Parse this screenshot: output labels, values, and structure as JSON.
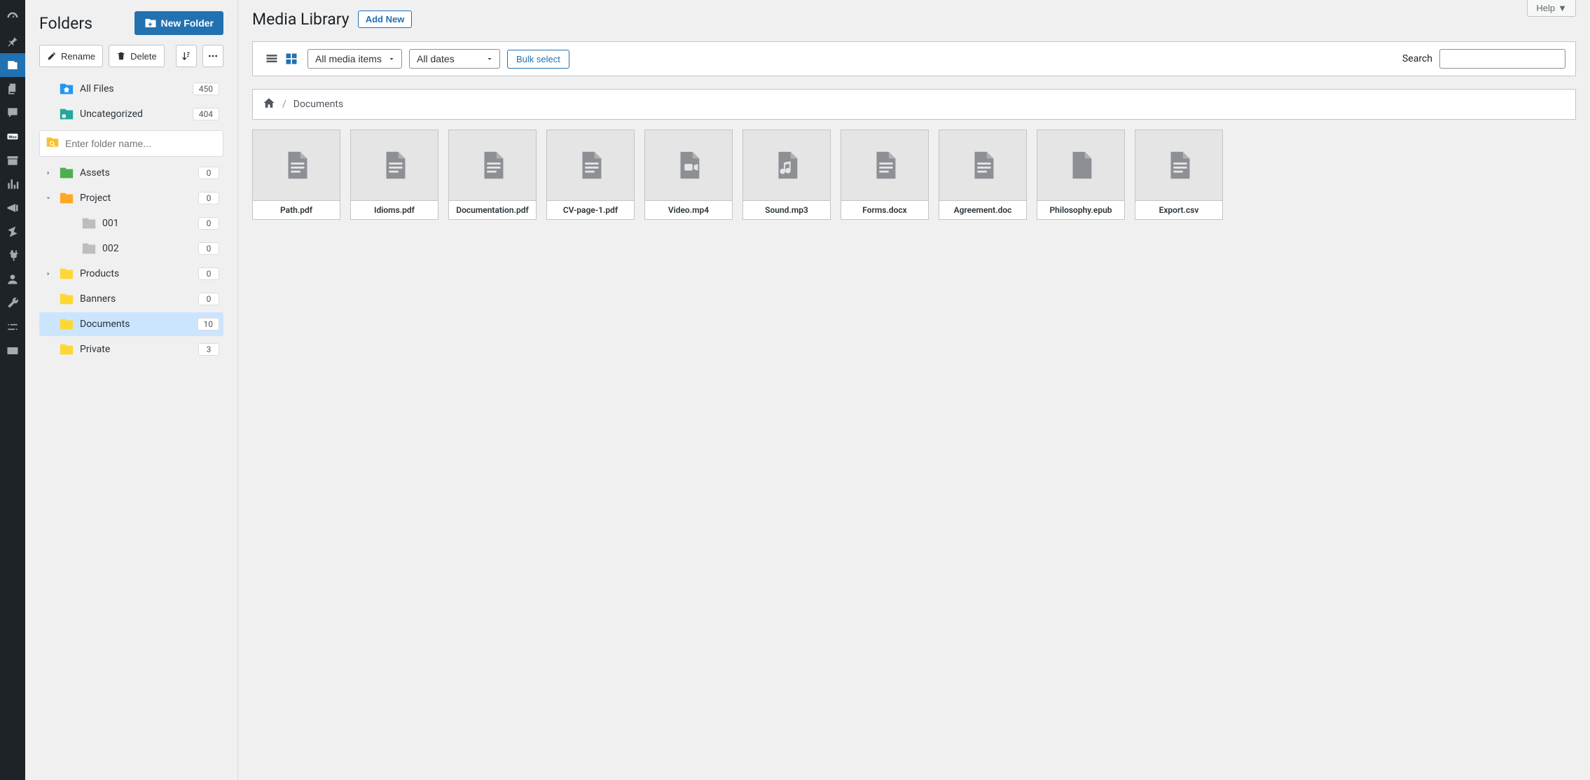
{
  "help_label": "Help",
  "folders": {
    "title": "Folders",
    "new_folder_label": "New Folder",
    "rename_label": "Rename",
    "delete_label": "Delete",
    "search_placeholder": "Enter folder name...",
    "all_files_label": "All Files",
    "all_files_count": "450",
    "uncategorized_label": "Uncategorized",
    "uncategorized_count": "404",
    "tree": [
      {
        "label": "Assets",
        "count": "0"
      },
      {
        "label": "Project",
        "count": "0"
      },
      {
        "label": "001",
        "count": "0"
      },
      {
        "label": "002",
        "count": "0"
      },
      {
        "label": "Products",
        "count": "0"
      },
      {
        "label": "Banners",
        "count": "0"
      },
      {
        "label": "Documents",
        "count": "10"
      },
      {
        "label": "Private",
        "count": "3"
      }
    ]
  },
  "main": {
    "title": "Media Library",
    "add_new_label": "Add New",
    "filter_media": "All media items",
    "filter_dates": "All dates",
    "bulk_select_label": "Bulk select",
    "search_label": "Search",
    "breadcrumb_current": "Documents"
  },
  "files": [
    {
      "name": "Path.pdf",
      "type": "doc"
    },
    {
      "name": "Idioms.pdf",
      "type": "doc"
    },
    {
      "name": "Documentation.pdf",
      "type": "doc"
    },
    {
      "name": "CV-page-1.pdf",
      "type": "doc"
    },
    {
      "name": "Video.mp4",
      "type": "video"
    },
    {
      "name": "Sound.mp3",
      "type": "audio"
    },
    {
      "name": "Forms.docx",
      "type": "doc"
    },
    {
      "name": "Agreement.doc",
      "type": "doc"
    },
    {
      "name": "Philosophy.epub",
      "type": "blank"
    },
    {
      "name": "Export.csv",
      "type": "doc"
    }
  ]
}
